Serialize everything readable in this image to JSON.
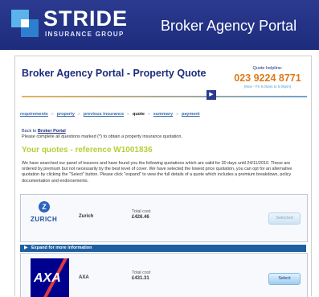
{
  "header": {
    "brand": "STRIDE",
    "brand_sub": "INSURANCE GROUP",
    "portal_title": "Broker Agency Portal",
    "colors": {
      "header_bg": "#1d2c7c",
      "logo_light": "#5ab3ea",
      "logo_mid": "#2e7fd0"
    }
  },
  "main": {
    "title": "Broker Agency Portal - Property Quote",
    "helpline": {
      "label": "Quote helpline:",
      "number": "023 9224 8771",
      "hours": "(Mon - Fri 9.00am to 5.00pm)"
    },
    "steps": [
      {
        "label": "requirements",
        "current": false
      },
      {
        "label": "property",
        "current": false
      },
      {
        "label": "previous insurance",
        "current": false
      },
      {
        "label": "quote",
        "current": true
      },
      {
        "label": "summary",
        "current": false
      },
      {
        "label": "payment",
        "current": false
      }
    ],
    "back": {
      "prefix": "Back to",
      "link": "Broker Portal"
    },
    "instruction": "Please complete all questions marked (*) to obtain a property insurance quotation.",
    "quotes_heading": "Your quotes - reference W1001836",
    "paragraph": "We have searched our panel of insurers and have found you the following quotations which are valid for 30 days until 24/11/2010. These are ordered by premium but not necessarily by the best level of cover. We have selected the lowest price quotation, you can opt for an alternative quotation by clicking the \"Select\" button. Please click \"expand\" to view the full details of a quote which includes a premium breakdown, policy documentation and endorsements.",
    "quotes": [
      {
        "insurer": "Zurich",
        "logo_text": "ZURICH",
        "total_label": "Total cost",
        "total": "£426.46",
        "button": "Selected",
        "selected": true
      },
      {
        "insurer": "AXA",
        "logo_text": "AXA",
        "total_label": "Total cost",
        "total": "£431.31",
        "button": "Select",
        "selected": false
      }
    ],
    "expand_label": "Expand for more information"
  }
}
